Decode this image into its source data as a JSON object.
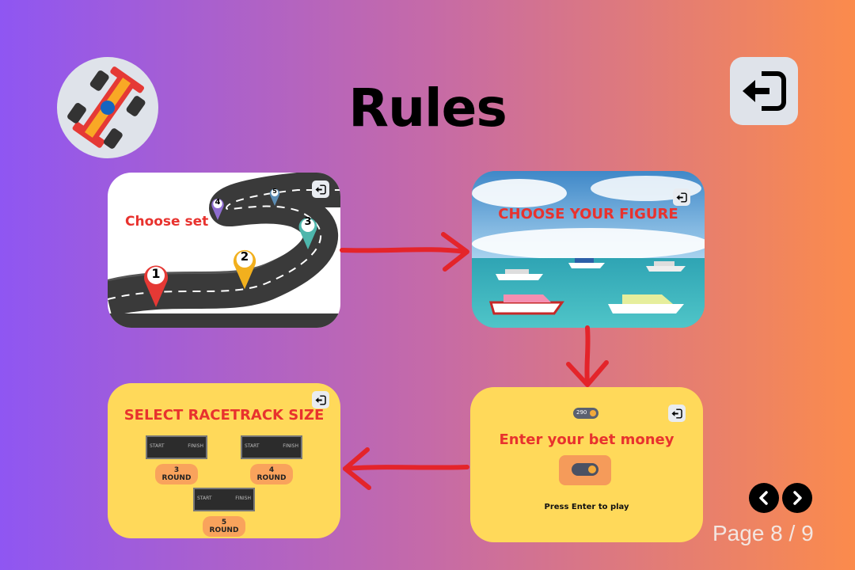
{
  "title": "Rules",
  "header": {
    "logo_icon": "race-car-icon",
    "exit_icon": "exit-icon"
  },
  "panels": {
    "choose_set": {
      "label": "Choose set",
      "markers": [
        "1",
        "2",
        "3",
        "4",
        "5"
      ]
    },
    "choose_figure": {
      "label": "CHOOSE YOUR FIGURE"
    },
    "bet_money": {
      "label": "Enter your bet money",
      "chip_value": "290",
      "hint": "Press Enter to play"
    },
    "racetrack_size": {
      "label": "SELECT RACETRACK SIZE",
      "options": [
        "3 ROUND",
        "4 ROUND",
        "5 ROUND"
      ],
      "track_text": {
        "start": "START",
        "finish": "FINISH"
      }
    }
  },
  "pagination": {
    "label": "Page 8 / 9"
  },
  "colors": {
    "accent_red": "#e8322e",
    "panel_yellow": "#ffd95a",
    "arrow_red": "#e4242a"
  }
}
